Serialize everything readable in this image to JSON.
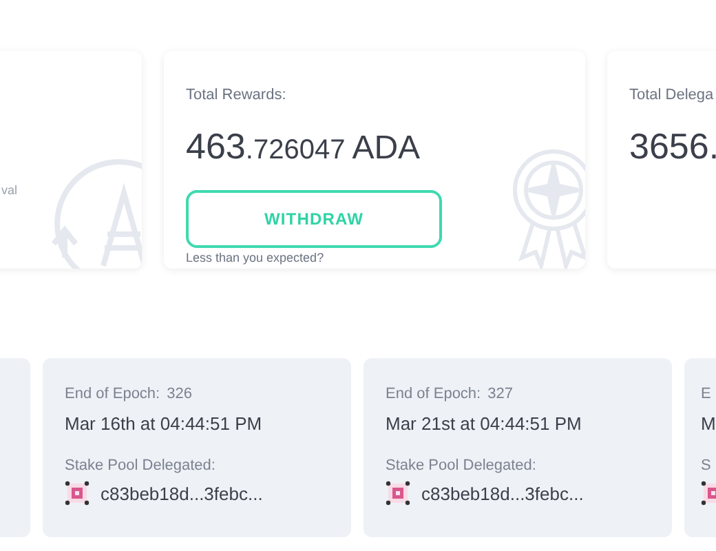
{
  "summary_cards": [
    {
      "kind": "partial",
      "note": "val"
    },
    {
      "kind": "rewards",
      "label": "Total Rewards:",
      "amount_integer": "463",
      "amount_decimal": ".726047",
      "currency": "ADA",
      "button": "WITHDRAW",
      "hint": "Less than you expected?"
    },
    {
      "kind": "delegated",
      "label": "Total Delega",
      "amount_integer": "3656."
    }
  ],
  "epoch_cards": [
    {
      "kind": "empty"
    },
    {
      "kind": "full",
      "epoch_label": "End of Epoch:",
      "epoch": "326",
      "date": "Mar 16th at 04:44:51 PM",
      "pool_label": "Stake Pool Delegated:",
      "pool_id": "c83beb18d...3febc..."
    },
    {
      "kind": "full",
      "epoch_label": "End of Epoch:",
      "epoch": "327",
      "date": "Mar 21st at 04:44:51 PM",
      "pool_label": "Stake Pool Delegated:",
      "pool_id": "c83beb18d...3febc..."
    },
    {
      "kind": "cut",
      "epoch_label": "E",
      "date": "M",
      "pool_label": "S"
    }
  ]
}
